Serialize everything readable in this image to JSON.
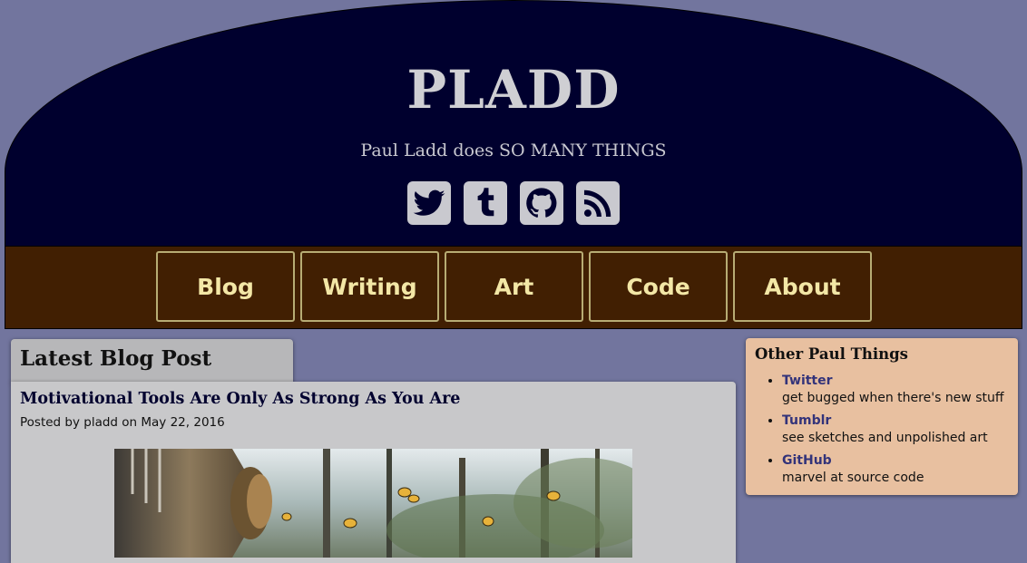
{
  "header": {
    "title": "PLADD",
    "tagline": "Paul Ladd does SO MANY THINGS",
    "social": [
      {
        "icon": "twitter-icon"
      },
      {
        "icon": "tumblr-icon"
      },
      {
        "icon": "github-icon"
      },
      {
        "icon": "rss-icon"
      }
    ]
  },
  "nav": {
    "items": [
      {
        "label": "Blog"
      },
      {
        "label": "Writing"
      },
      {
        "label": "Art"
      },
      {
        "label": "Code"
      },
      {
        "label": "About"
      }
    ]
  },
  "main": {
    "section_title": "Latest Blog Post",
    "post": {
      "title": "Motivational Tools Are Only As Strong As You Are",
      "meta": "Posted by pladd on May 22, 2016"
    }
  },
  "sidebar": {
    "title": "Other Paul Things",
    "items": [
      {
        "link": "Twitter",
        "desc": "get bugged when there's new stuff"
      },
      {
        "link": "Tumblr",
        "desc": "see sketches and unpolished art"
      },
      {
        "link": "GitHub",
        "desc": "marvel at source code"
      }
    ]
  },
  "colors": {
    "page_bg": "#72759e",
    "header_bg": "#00002e",
    "nav_bg": "#411f02",
    "nav_text": "#f3e7a6",
    "sidebar_bg": "#e8c0a0"
  }
}
